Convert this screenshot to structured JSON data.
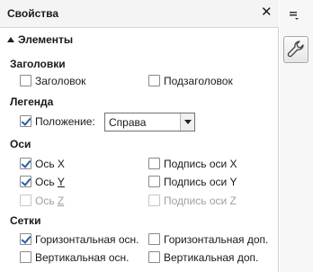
{
  "panel": {
    "title": "Свойства",
    "close_symbol": "✕",
    "section_title": "Элементы"
  },
  "titles": {
    "label": "Заголовки",
    "title": {
      "label": "Заголовок",
      "checked": false
    },
    "subtitle": {
      "label": "Подзаголовок",
      "checked": false
    }
  },
  "legend": {
    "label": "Легенда",
    "position": {
      "label_pre": "Положение",
      "label_post": ":",
      "checked": true
    },
    "position_value": "Справа"
  },
  "axes": {
    "label": "Оси",
    "x_axis": {
      "label": "Ось X",
      "checked": true
    },
    "y_axis": {
      "label_pre": "Ось ",
      "label_u": "Y",
      "checked": true
    },
    "z_axis": {
      "label_pre": "Ось ",
      "label_u": "Z",
      "checked": false,
      "disabled": true
    },
    "x_title": {
      "label": "Подпись оси X",
      "checked": false
    },
    "y_title": {
      "label": "Подпись оси Y",
      "checked": false
    },
    "z_title": {
      "label": "Подпись оси Z",
      "checked": false,
      "disabled": true
    }
  },
  "grids": {
    "label": "Сетки",
    "h_major": {
      "label": "Горизонтальная осн.",
      "checked": true
    },
    "h_minor": {
      "label": "Горизонтальная доп.",
      "checked": false
    },
    "v_major": {
      "label": "Вертикальная осн.",
      "checked": false
    },
    "v_minor": {
      "label": "Вертикальная доп.",
      "checked": false
    }
  },
  "sidebar": {
    "menu_icon": "hamburger-menu-icon",
    "properties_icon": "wrench-icon"
  },
  "colors": {
    "check": "#2a5ea8",
    "disabled_text": "#a0a0a0"
  }
}
